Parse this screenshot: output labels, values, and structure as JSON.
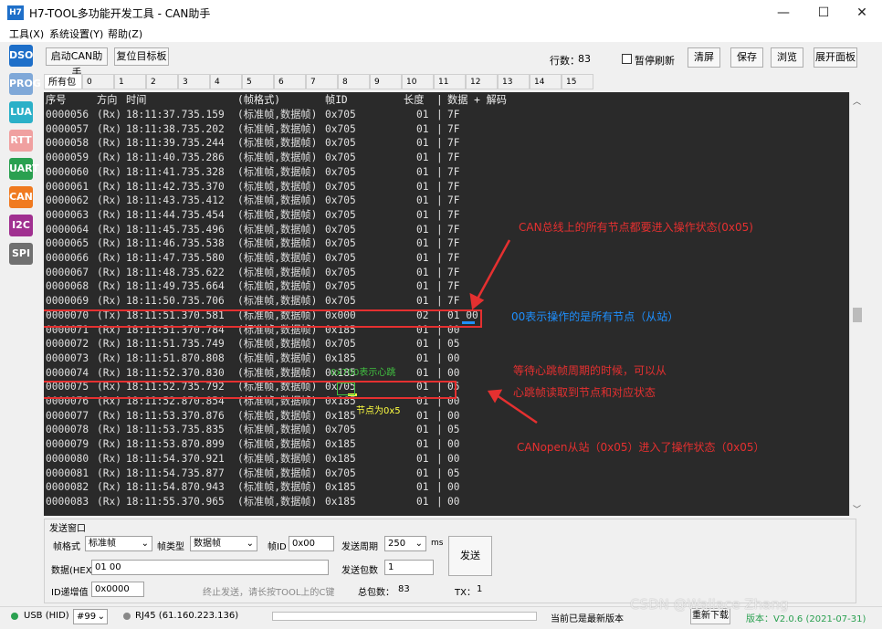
{
  "window": {
    "title": "H7-TOOL多功能开发工具 - CAN助手",
    "icon_text": "H7",
    "min": "—",
    "max": "☐",
    "close": "✕"
  },
  "menu": [
    "工具(X)",
    "系统设置(Y)",
    "帮助(Z)"
  ],
  "sidebar": [
    {
      "label": "DSO",
      "color": "#1e6fc9"
    },
    {
      "label": "PROG",
      "color": "#7fa8d8"
    },
    {
      "label": "LUA",
      "color": "#2bb0c8"
    },
    {
      "label": "RTT",
      "color": "#f0a0a0"
    },
    {
      "label": "UART",
      "color": "#2aa050"
    },
    {
      "label": "CAN",
      "color": "#f07a20"
    },
    {
      "label": "I2C",
      "color": "#a03090"
    },
    {
      "label": "SPI",
      "color": "#707070"
    }
  ],
  "toolbar": {
    "start": "启动CAN助手",
    "reset": "复位目标板",
    "rows_label": "行数：",
    "rows_value": "83",
    "pause": "暂停刷新",
    "clear": "清屏",
    "save": "保存",
    "browse": "浏览",
    "expand": "展开面板"
  },
  "tabs": [
    "所有包",
    "0",
    "1",
    "2",
    "3",
    "4",
    "5",
    "6",
    "7",
    "8",
    "9",
    "10",
    "11",
    "12",
    "13",
    "14",
    "15"
  ],
  "log": {
    "header": {
      "seq": "序号",
      "dir": "方向",
      "time": "时间",
      "fmt": "(帧格式)",
      "id": "帧ID",
      "len": "长度",
      "sep": "|",
      "data": "数据 + 解码"
    },
    "rows": [
      [
        "0000056",
        "(Rx)",
        "18:11:37.735.159",
        "(标准帧,数据帧)",
        "0x705",
        "01",
        "7F"
      ],
      [
        "0000057",
        "(Rx)",
        "18:11:38.735.202",
        "(标准帧,数据帧)",
        "0x705",
        "01",
        "7F"
      ],
      [
        "0000058",
        "(Rx)",
        "18:11:39.735.244",
        "(标准帧,数据帧)",
        "0x705",
        "01",
        "7F"
      ],
      [
        "0000059",
        "(Rx)",
        "18:11:40.735.286",
        "(标准帧,数据帧)",
        "0x705",
        "01",
        "7F"
      ],
      [
        "0000060",
        "(Rx)",
        "18:11:41.735.328",
        "(标准帧,数据帧)",
        "0x705",
        "01",
        "7F"
      ],
      [
        "0000061",
        "(Rx)",
        "18:11:42.735.370",
        "(标准帧,数据帧)",
        "0x705",
        "01",
        "7F"
      ],
      [
        "0000062",
        "(Rx)",
        "18:11:43.735.412",
        "(标准帧,数据帧)",
        "0x705",
        "01",
        "7F"
      ],
      [
        "0000063",
        "(Rx)",
        "18:11:44.735.454",
        "(标准帧,数据帧)",
        "0x705",
        "01",
        "7F"
      ],
      [
        "0000064",
        "(Rx)",
        "18:11:45.735.496",
        "(标准帧,数据帧)",
        "0x705",
        "01",
        "7F"
      ],
      [
        "0000065",
        "(Rx)",
        "18:11:46.735.538",
        "(标准帧,数据帧)",
        "0x705",
        "01",
        "7F"
      ],
      [
        "0000066",
        "(Rx)",
        "18:11:47.735.580",
        "(标准帧,数据帧)",
        "0x705",
        "01",
        "7F"
      ],
      [
        "0000067",
        "(Rx)",
        "18:11:48.735.622",
        "(标准帧,数据帧)",
        "0x705",
        "01",
        "7F"
      ],
      [
        "0000068",
        "(Rx)",
        "18:11:49.735.664",
        "(标准帧,数据帧)",
        "0x705",
        "01",
        "7F"
      ],
      [
        "0000069",
        "(Rx)",
        "18:11:50.735.706",
        "(标准帧,数据帧)",
        "0x705",
        "01",
        "7F"
      ],
      [
        "0000070",
        "(Tx)",
        "18:11:51.370.581",
        "(标准帧,数据帧)",
        "0x000",
        "02",
        "01 00"
      ],
      [
        "0000071",
        "(Rx)",
        "18:11:51.370.784",
        "(标准帧,数据帧)",
        "0x185",
        "01",
        "00"
      ],
      [
        "0000072",
        "(Rx)",
        "18:11:51.735.749",
        "(标准帧,数据帧)",
        "0x705",
        "01",
        "05"
      ],
      [
        "0000073",
        "(Rx)",
        "18:11:51.870.808",
        "(标准帧,数据帧)",
        "0x185",
        "01",
        "00"
      ],
      [
        "0000074",
        "(Rx)",
        "18:11:52.370.830",
        "(标准帧,数据帧)",
        "0x185",
        "01",
        "00"
      ],
      [
        "0000075",
        "(Rx)",
        "18:11:52.735.792",
        "(标准帧,数据帧)",
        "0x705",
        "01",
        "05"
      ],
      [
        "0000076",
        "(Rx)",
        "18:11:52.870.854",
        "(标准帧,数据帧)",
        "0x185",
        "01",
        "00"
      ],
      [
        "0000077",
        "(Rx)",
        "18:11:53.370.876",
        "(标准帧,数据帧)",
        "0x185",
        "01",
        "00"
      ],
      [
        "0000078",
        "(Rx)",
        "18:11:53.735.835",
        "(标准帧,数据帧)",
        "0x705",
        "01",
        "05"
      ],
      [
        "0000079",
        "(Rx)",
        "18:11:53.870.899",
        "(标准帧,数据帧)",
        "0x185",
        "01",
        "00"
      ],
      [
        "0000080",
        "(Rx)",
        "18:11:54.370.921",
        "(标准帧,数据帧)",
        "0x185",
        "01",
        "00"
      ],
      [
        "0000081",
        "(Rx)",
        "18:11:54.735.877",
        "(标准帧,数据帧)",
        "0x705",
        "01",
        "05"
      ],
      [
        "0000082",
        "(Rx)",
        "18:11:54.870.943",
        "(标准帧,数据帧)",
        "0x185",
        "01",
        "00"
      ],
      [
        "0000083",
        "(Rx)",
        "18:11:55.370.965",
        "(标准帧,数据帧)",
        "0x185",
        "01",
        "00"
      ]
    ]
  },
  "annotations": {
    "a1": "CAN总线上的所有节点都要进入操作状态(0x05)",
    "a2": "00表示操作的是所有节点（从站）",
    "a3_line1": "等待心跳帧周期的时候，可以从",
    "a3_line2": "心跳帧读取到节点和对应状态",
    "a4": "CANopen从站（0x05）进入了操作状态（0x05）",
    "small1": "0x700表示心跳",
    "small2": "节点为0x5"
  },
  "send": {
    "title": "发送窗口",
    "frame_fmt_label": "帧格式",
    "frame_fmt_value": "标准帧",
    "frame_type_label": "帧类型",
    "frame_type_value": "数据帧",
    "id_label": "帧ID",
    "id_value": "0x00",
    "period_label": "发送周期",
    "period_value": "250",
    "period_unit": "ms",
    "data_label": "数据(HEX)",
    "data_value": "01 00",
    "count_label": "发送包数",
    "count_value": "1",
    "id_inc_label": "ID递增值",
    "id_inc_value": "0x0000",
    "stop_hint": "终止发送，请长按TOOL上的C键",
    "total_label": "总包数：",
    "total_value": "83",
    "tx_label": "TX：",
    "tx_value": "1",
    "send_btn": "发送"
  },
  "status": {
    "usb": "USB (HID)",
    "dev": "#99",
    "rj45": "RJ45 (61.160.223.136)",
    "latest": "当前已是最新版本",
    "recheck": "重新下载",
    "version": "版本：V2.0.6 (2021-07-31)",
    "watermark": "CSDN @Wallace Zhang"
  },
  "colors": {
    "log_bg": "#2a2a2a",
    "annotation_red": "#e53030",
    "annotation_blue": "#1e90ff",
    "annotation_green": "#40c040",
    "annotation_yellow": "#ffff40"
  }
}
